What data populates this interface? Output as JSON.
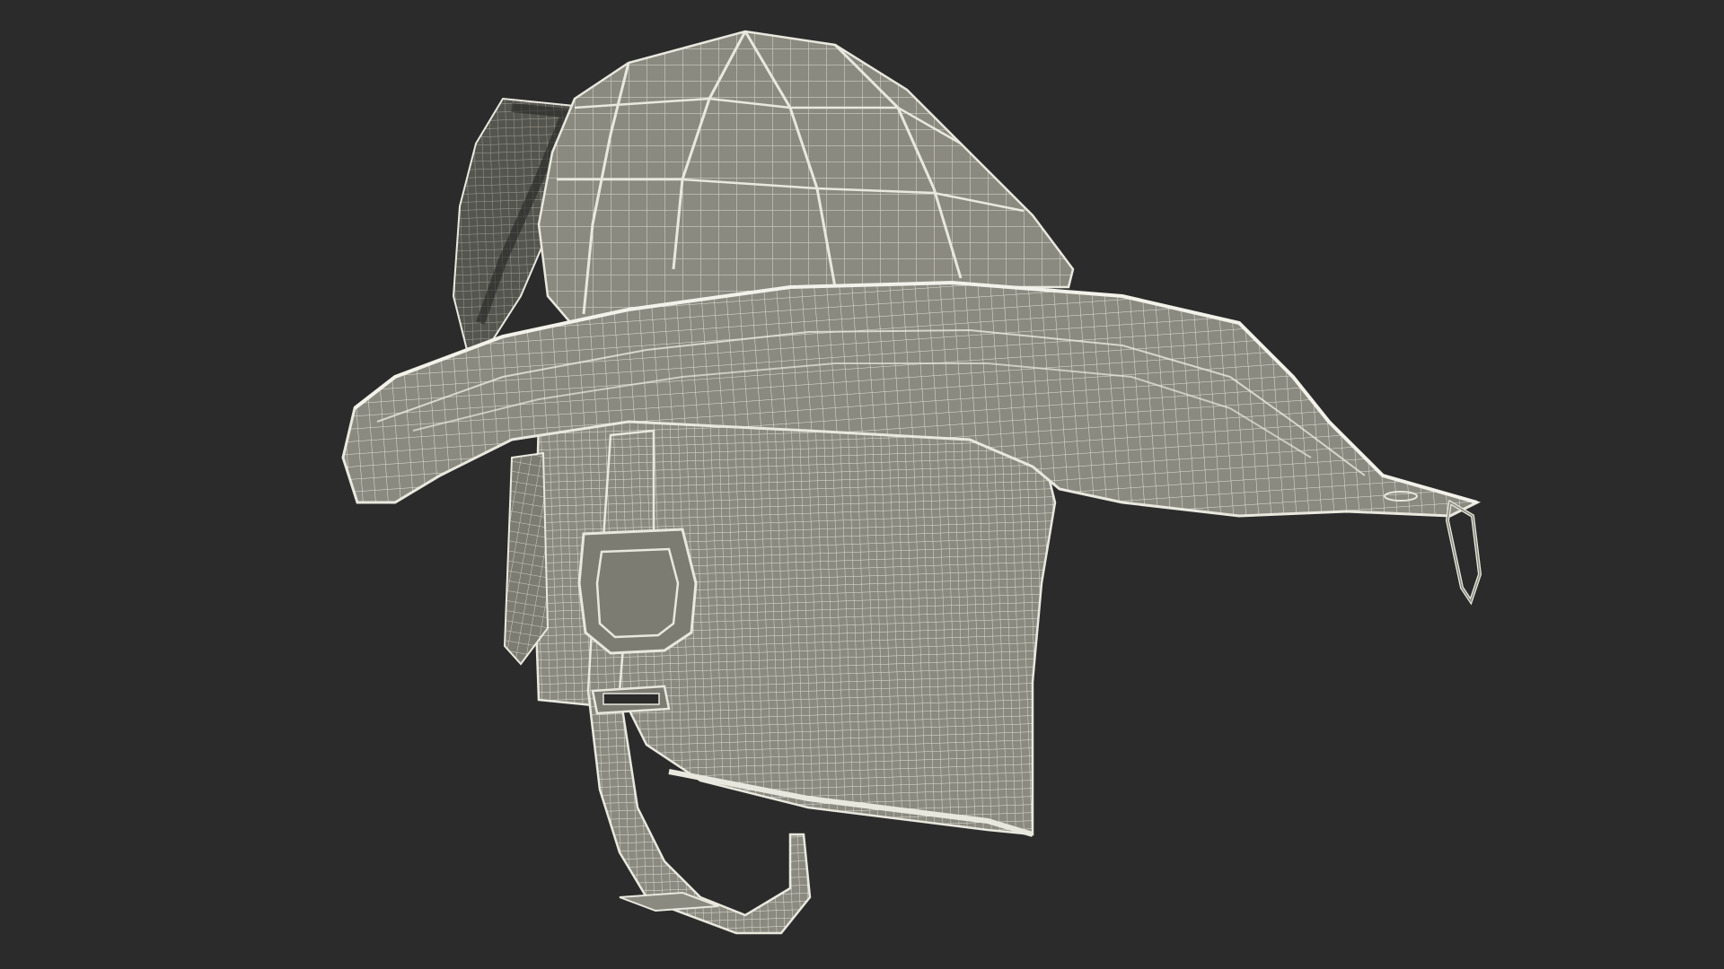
{
  "viewport": {
    "background_color": "#2b2b2b",
    "subject": "firefighter-helmet-wireframe"
  },
  "material": {
    "surface_color": "#8b8a80",
    "surface_dark": "#6f6e66",
    "surface_light": "#a3a297",
    "wire_color": "#f2f2ea",
    "edge_color": "#e8e8df"
  }
}
